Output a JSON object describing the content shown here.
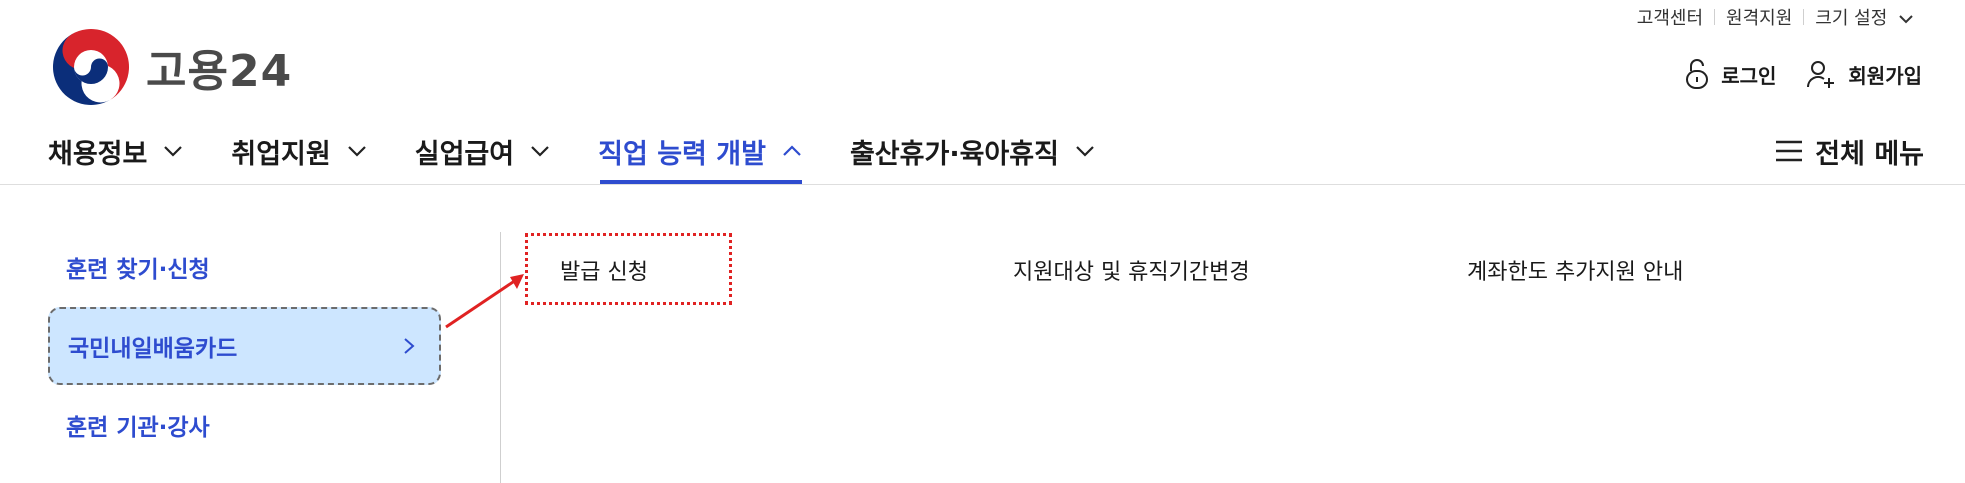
{
  "utility": {
    "customer_center": "고객센터",
    "remote_support": "원격지원",
    "font_size": "크기 설정"
  },
  "logo": {
    "text": "고용24"
  },
  "account": {
    "login": "로그인",
    "signup": "회원가입"
  },
  "nav": {
    "items": [
      {
        "label": "채용정보"
      },
      {
        "label": "취업지원"
      },
      {
        "label": "실업급여"
      },
      {
        "label": "직업 능력 개발"
      },
      {
        "label": "출산휴가·육아휴직"
      }
    ],
    "all_menu": "전체 메뉴"
  },
  "submenu": {
    "items": [
      {
        "label": "훈련 찾기·신청"
      },
      {
        "label": "국민내일배움카드"
      },
      {
        "label": "훈련 기관·강사"
      }
    ]
  },
  "submenu2": {
    "items": [
      {
        "label": "발급 신청"
      },
      {
        "label": "지원대상 및 휴직기간변경"
      },
      {
        "label": "계좌한도 추가지원 안내"
      }
    ]
  },
  "colors": {
    "accent": "#2e4ccf",
    "highlight_fill": "#cde6ff",
    "annotation": "#e02222"
  }
}
